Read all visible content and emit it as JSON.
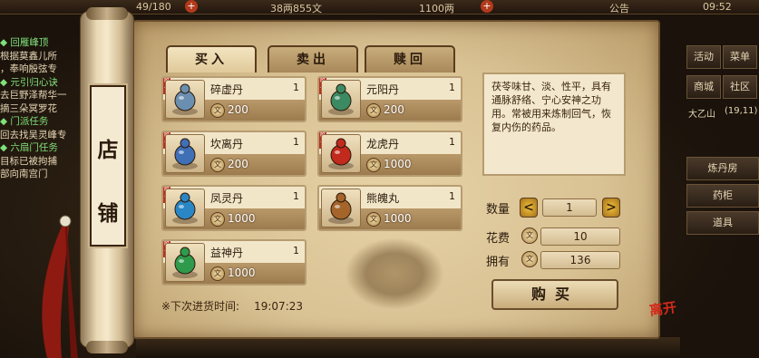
{
  "status_bar": {
    "stamina": "49/180",
    "silver": "38两855文",
    "gold": "1100两",
    "notice": "公告",
    "clock": "09:52"
  },
  "quest_log": [
    {
      "type": "title",
      "text": "◆ 回雁峰顶"
    },
    {
      "type": "text",
      "text": "根据莫鑫儿所"
    },
    {
      "type": "text",
      "text": "，奉响殷弦专"
    },
    {
      "type": "title",
      "text": "◆ 元引归心诀"
    },
    {
      "type": "text",
      "text": "去巨野泽帮华一"
    },
    {
      "type": "text",
      "text": "摘三朵冥罗花"
    },
    {
      "type": "title",
      "text": "◆ 门派任务"
    },
    {
      "type": "text",
      "text": "回去找吴灵峰专"
    },
    {
      "type": "title",
      "text": "◆ 六扇门任务"
    },
    {
      "type": "text",
      "text": "目标已被拘捕"
    },
    {
      "type": "text",
      "text": "部向南宫门"
    }
  ],
  "side_panel": {
    "buttons": [
      "活动",
      "菜单",
      "商城",
      "社区"
    ],
    "location": "大乙山",
    "coords": "(19,11)",
    "shortcuts": [
      "炼丹房",
      "药柜",
      "道具"
    ]
  },
  "shop": {
    "plaque_chars": [
      "店",
      "铺"
    ],
    "tabs": [
      "买入",
      "卖出",
      "赎回"
    ],
    "active_tab": 0,
    "coin_glyph": "文",
    "items": [
      {
        "name": "碎虚丹",
        "qty": "1",
        "price": "200",
        "tag": "唯一",
        "color": "#6a8fb0"
      },
      {
        "name": "元阳丹",
        "qty": "1",
        "price": "200",
        "tag": "唯一",
        "color": "#3b8a62"
      },
      {
        "name": "坎离丹",
        "qty": "1",
        "price": "200",
        "tag": "唯一",
        "color": "#3f6fb5"
      },
      {
        "name": "龙虎丹",
        "qty": "1",
        "price": "1000",
        "tag": "唯一",
        "color": "#c12a1c"
      },
      {
        "name": "凤灵丹",
        "qty": "1",
        "price": "1000",
        "tag": "唯一",
        "color": "#2a86c4"
      },
      {
        "name": "熊魄丸",
        "qty": "1",
        "price": "1000",
        "tag": "",
        "color": "#a4642a"
      },
      {
        "name": "益神丹",
        "qty": "1",
        "price": "1000",
        "tag": "唯一",
        "color": "#2f9a4c"
      }
    ],
    "restock_label": "※下次进货时间:",
    "restock_time": "19:07:23",
    "description": "茯苓味甘、淡、性平，具有通脉舒络、宁心安神之功用。常被用来炼制回气，恢复内伤的药品。",
    "quantity_label": "数量",
    "quantity_value": "1",
    "cost_label": "花费",
    "cost_value": "10",
    "owned_label": "拥有",
    "owned_value": "136",
    "buy_label": "购买",
    "seal_text": "离开"
  }
}
